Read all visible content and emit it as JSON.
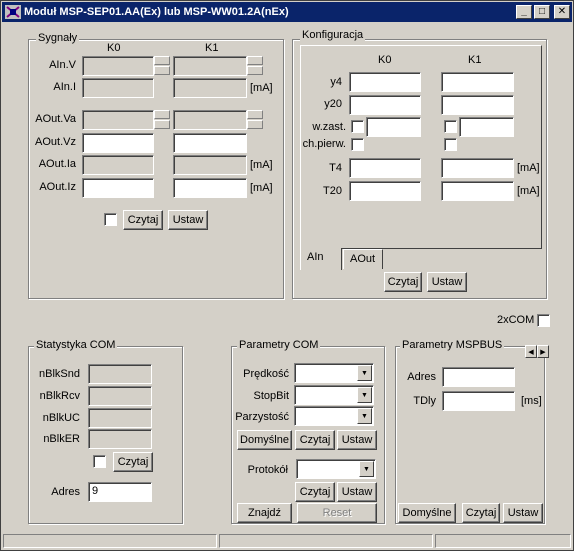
{
  "window": {
    "title": "Moduł MSP-SEP01.AA(Ex) lub MSP-WW01.2A(nEx)",
    "minimize_icon": "minimize-icon",
    "maximize_icon": "maximize-icon",
    "close_icon": "close-icon",
    "minimize_glyph": "_",
    "maximize_glyph": "□",
    "close_glyph": "✕"
  },
  "sygnaly": {
    "title": "Sygnały",
    "col_k0": "K0",
    "col_k1": "K1",
    "rows": [
      {
        "label": "AIn.V",
        "k0": "",
        "k1": "",
        "unit": ""
      },
      {
        "label": "AIn.I",
        "k0": "",
        "k1": "",
        "unit": "[mA]"
      },
      {
        "label": "AOut.Va",
        "k0": "",
        "k1": "",
        "unit": ""
      },
      {
        "label": "AOut.Vz",
        "k0": "",
        "k1": "",
        "unit": ""
      },
      {
        "label": "AOut.Ia",
        "k0": "",
        "k1": "",
        "unit": "[mA]"
      },
      {
        "label": "AOut.Iz",
        "k0": "",
        "k1": "",
        "unit": "[mA]"
      }
    ],
    "read_button": "Czytaj",
    "set_button": "Ustaw"
  },
  "konfiguracja": {
    "title": "Konfiguracja",
    "col_k0": "K0",
    "col_k1": "K1",
    "y4_label": "y4",
    "y20_label": "y20",
    "wzast_label": "w.zast.",
    "chpierw_label": "ch.pierw.",
    "t4_label": "T4",
    "t20_label": "T20",
    "unit_ma": "[mA]",
    "tab_ain": "AIn",
    "tab_aout": "AOut",
    "read_button": "Czytaj",
    "set_button": "Ustaw"
  },
  "twocom": {
    "label": "2xCOM"
  },
  "statystyka": {
    "title": "Statystyka COM",
    "rows": [
      "nBlkSnd",
      "nBlkRcv",
      "nBlkUC",
      "nBlkER"
    ],
    "read_button": "Czytaj",
    "adres_label": "Adres",
    "adres_value": "9"
  },
  "parametry_com": {
    "title": "Parametry COM",
    "predkosc_label": "Prędkość",
    "stopbit_label": "StopBit",
    "parzystosc_label": "Parzystość",
    "default_button": "Domyślne",
    "read_button": "Czytaj",
    "set_button": "Ustaw",
    "protokol_label": "Protokół",
    "find_button": "Znajdź",
    "reset_button": "Reset"
  },
  "parametry_mspbus": {
    "title": "Parametry MSPBUS",
    "adres_label": "Adres",
    "tdly_label": "TDly",
    "tdly_unit": "[ms]",
    "default_button": "Domyślne",
    "read_button": "Czytaj",
    "set_button": "Ustaw"
  }
}
